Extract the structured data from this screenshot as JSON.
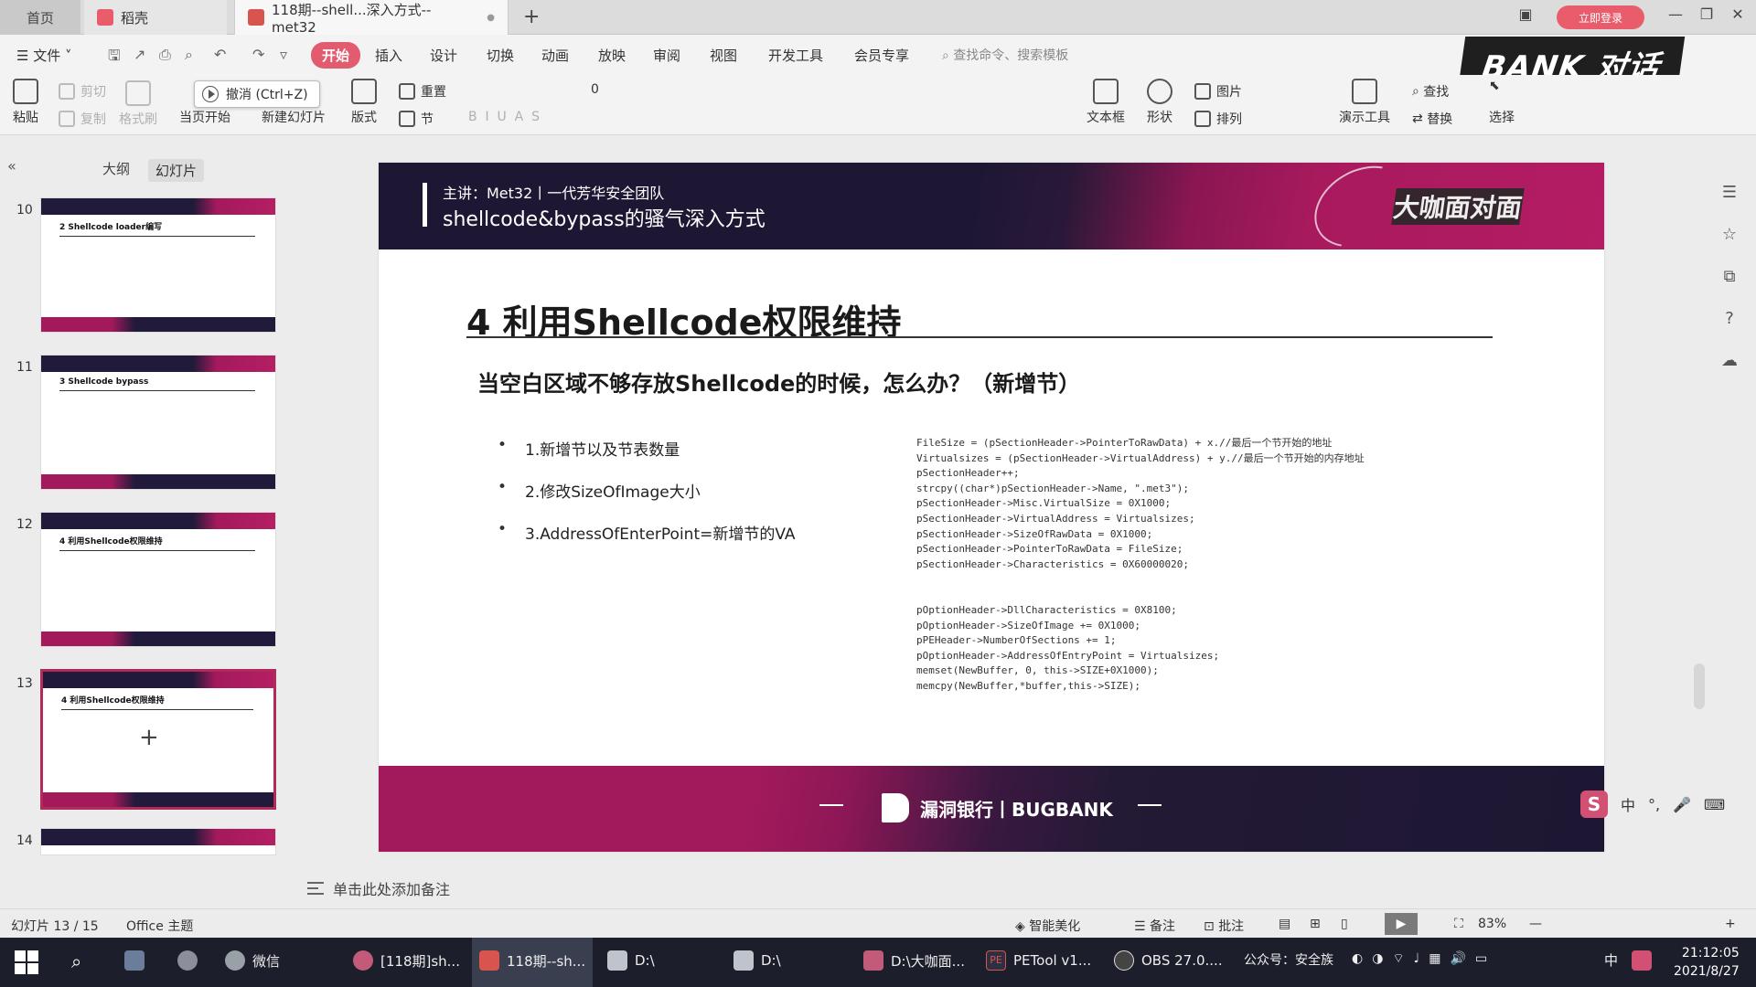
{
  "tabs": {
    "home": "首页",
    "daoke": "稻壳",
    "document": "118期--shell...深入方式--met32",
    "new_tab": "+",
    "login": "立即登录"
  },
  "window_controls": [
    "—",
    "❐",
    "✕"
  ],
  "menu": {
    "file": "文件",
    "items": [
      "开始",
      "插入",
      "设计",
      "切换",
      "动画",
      "放映",
      "审阅",
      "视图",
      "开发工具",
      "会员专享"
    ],
    "search_command": "查找命令、搜索模板"
  },
  "banner_logo": "BANK 对话",
  "ribbon": {
    "paste": "粘贴",
    "cut": "剪切",
    "copy": "复制",
    "format_painter": "格式刷",
    "from_current": "当页开始",
    "new_slide": "新建幻灯片",
    "layout": "版式",
    "section": "节",
    "reset": "重置",
    "font_size": "0",
    "textbox": "文本框",
    "shape": "形状",
    "arrange": "排列",
    "picture": "图片",
    "present_tools": "演示工具",
    "find": "查找",
    "replace": "替换",
    "select": "选择"
  },
  "tooltip": "撤消 (Ctrl+Z)",
  "left_panel": {
    "outline_tab": "大纲",
    "slides_tab": "幻灯片",
    "thumbnails": [
      {
        "num": "10",
        "title": "2 Shellcode loader编写"
      },
      {
        "num": "11",
        "title": "3 Shellcode bypass"
      },
      {
        "num": "12",
        "title": "4 利用Shellcode权限维持"
      },
      {
        "num": "13",
        "title": "4 利用Shellcode权限维持"
      },
      {
        "num": "14",
        "title": ""
      }
    ],
    "add_slide": "+"
  },
  "slide": {
    "presenter": "主讲：Met32丨一代芳华安全团队",
    "header_title": "shellcode&bypass的骚气深入方式",
    "badge": "大咖面对面",
    "title": "4 利用Shellcode权限维持",
    "subtitle": "当空白区域不够存放Shellcode的时候，怎么办？（新增节）",
    "bullets": [
      "1.新增节以及节表数量",
      "2.修改SizeOfImage大小",
      "3.AddressOfEnterPoint=新增节的VA"
    ],
    "code_block_1": [
      "FileSize = (pSectionHeader->PointerToRawData) + x.//最后一个节开始的地址",
      "Virtualsizes = (pSectionHeader->VirtualAddress) + y.//最后一个节开始的内存地址",
      "pSectionHeader++;",
      "strcpy((char*)pSectionHeader->Name, \".met3\");",
      "pSectionHeader->Misc.VirtualSize = 0X1000;",
      "pSectionHeader->VirtualAddress = Virtualsizes;",
      "pSectionHeader->SizeOfRawData = 0X1000;",
      "pSectionHeader->PointerToRawData = FileSize;",
      "pSectionHeader->Characteristics = 0X60000020;"
    ],
    "code_block_2": [
      "pOptionHeader->DllCharacteristics = 0X8100;",
      "pOptionHeader->SizeOfImage += 0X1000;",
      "pPEHeader->NumberOfSections += 1;",
      "pOptionHeader->AddressOfEntryPoint = Virtualsizes;",
      "memset(NewBuffer, 0, this->SIZE+0X1000);",
      "memcpy(NewBuffer,*buffer,this->SIZE);"
    ],
    "footer_text": "漏洞银行丨BUGBANK"
  },
  "notes_placeholder": "单击此处添加备注",
  "ime": [
    "中",
    "°,",
    "🎤",
    "⌨",
    "⚙"
  ],
  "status": {
    "slide_counter": "幻灯片 13 / 15",
    "theme": "Office 主题",
    "smart_beautify": "智能美化",
    "notes": "备注",
    "comments": "批注",
    "zoom": "83%"
  },
  "taskbar": {
    "items": [
      "微信",
      "[118期]sh...",
      "118期--sh...",
      "D:\\",
      "D:\\",
      "D:\\大咖面...",
      "PETool v1...",
      "OBS 27.0...."
    ],
    "tray_text": "公众号：安全族",
    "ime_indicator": "中",
    "time": "21:12:05",
    "date": "2021/8/27"
  },
  "colors": {
    "accent": "#e25b6f",
    "slide_dark": "#1d1733",
    "slide_magenta": "#a81a5d",
    "taskbar": "#1c1f2b"
  }
}
